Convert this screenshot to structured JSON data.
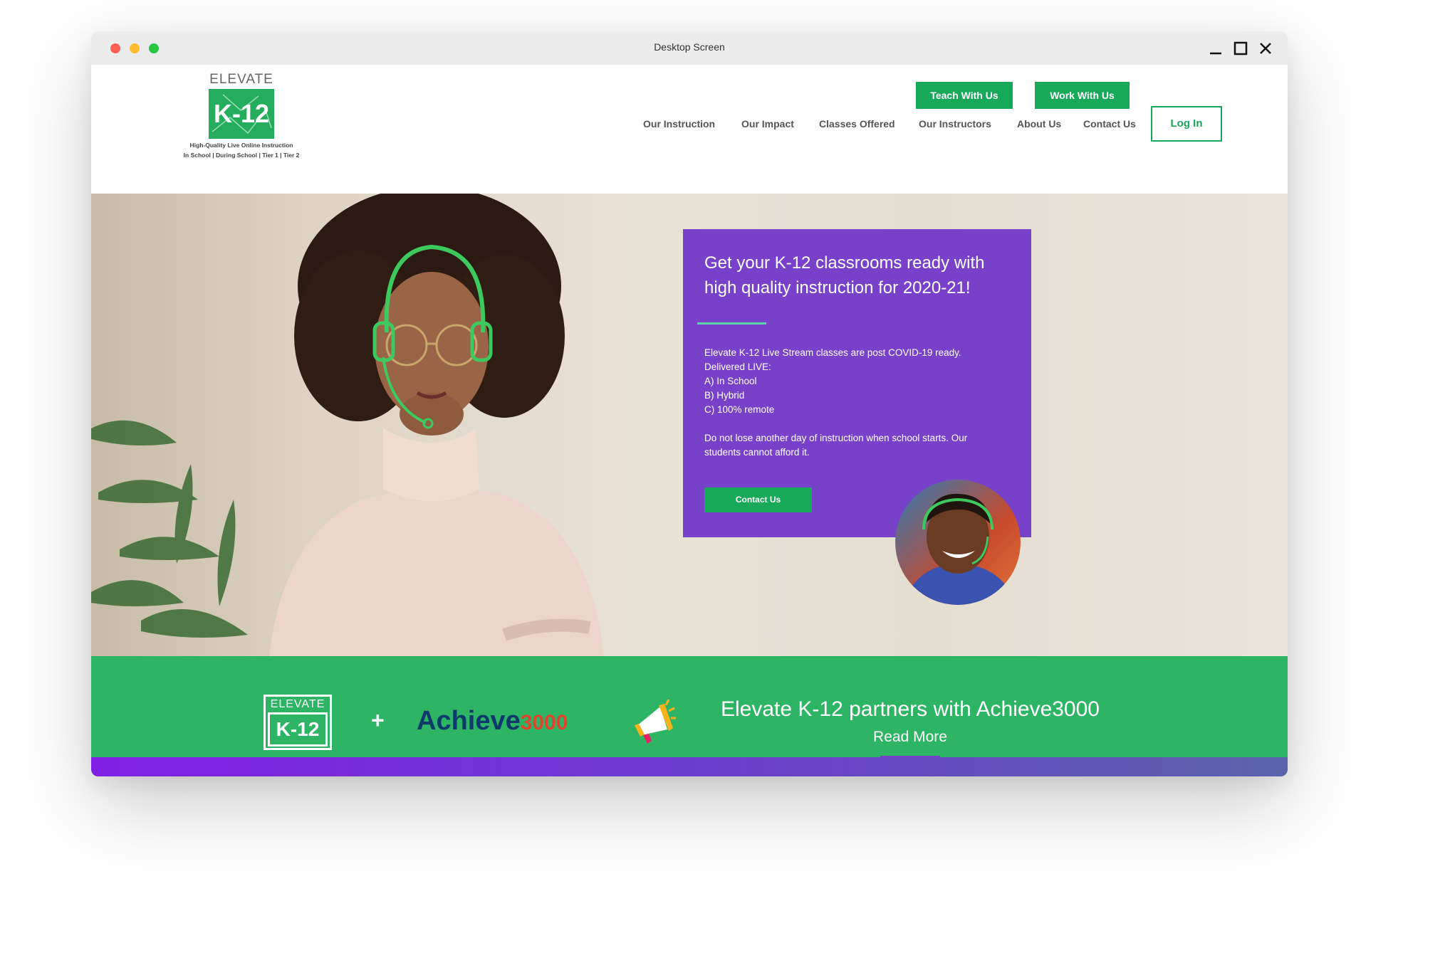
{
  "window": {
    "title": "Desktop Screen"
  },
  "logo": {
    "word": "ELEVATE",
    "mark": "K-12",
    "tagline1": "High-Quality Live Online Instruction",
    "tagline2": "In School | During School | Tier 1 | Tier 2"
  },
  "header": {
    "teach_btn": "Teach With Us",
    "work_btn": "Work With Us",
    "login_btn": "Log In",
    "nav": [
      "Our Instruction",
      "Our Impact",
      "Classes Offered",
      "Our Instructors",
      "About Us",
      "Contact Us"
    ]
  },
  "hero": {
    "title": "Get your K-12 classrooms ready with high quality instruction for 2020-21!",
    "body_lines": [
      "Elevate K-12 Live Stream classes are post COVID-19 ready.",
      "Delivered LIVE:",
      "A) In School",
      "B) Hybrid",
      "C) 100% remote"
    ],
    "body_para": "Do not lose another day of instruction when school starts. Our students cannot afford it.",
    "cta": "Contact Us"
  },
  "partner": {
    "logo_word": "ELEVATE",
    "logo_mark": "K-12",
    "plus": "+",
    "achieve_part1": "Achieve",
    "achieve_part2": "3000",
    "headline": "Elevate K-12 partners with Achieve3000",
    "read_more": "Read More"
  },
  "colors": {
    "brand_green": "#17a85a",
    "band_green": "#2db565",
    "purple": "#7742c9",
    "accent_teal": "#5dd3a6"
  }
}
